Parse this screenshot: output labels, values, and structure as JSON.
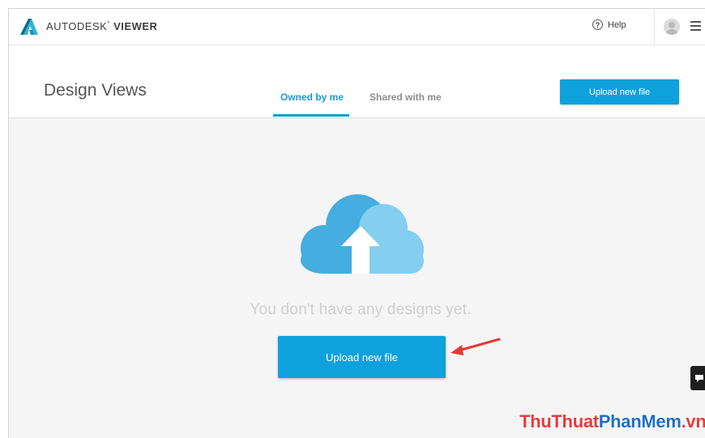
{
  "app": {
    "brand_part1": "AUTODESK",
    "brand_part2": "VIEWER",
    "help_label": "Help"
  },
  "header": {
    "title": "Design Views",
    "tabs": [
      {
        "label": "Owned by me",
        "active": true
      },
      {
        "label": "Shared with me",
        "active": false
      }
    ],
    "upload_label": "Upload new file"
  },
  "main": {
    "empty_message": "You don't have any designs yet.",
    "upload_label": "Upload new file"
  },
  "icons": {
    "logo": "autodesk-logo-icon",
    "help": "help-circle-icon",
    "avatar": "user-avatar-icon",
    "menu": "hamburger-menu-icon",
    "cloud": "cloud-upload-icon",
    "arrow": "red-arrow-icon",
    "feedback": "feedback-icon"
  },
  "colors": {
    "accent": "#0ea1dd",
    "tab_active": "#1b9ad6",
    "cloud_dark": "#45ade0",
    "cloud_light": "#84cef0",
    "arrow": "#e53935"
  },
  "watermark": {
    "part1": "ThuThuat",
    "part2": "PhanMem",
    "part3": ".vn"
  }
}
